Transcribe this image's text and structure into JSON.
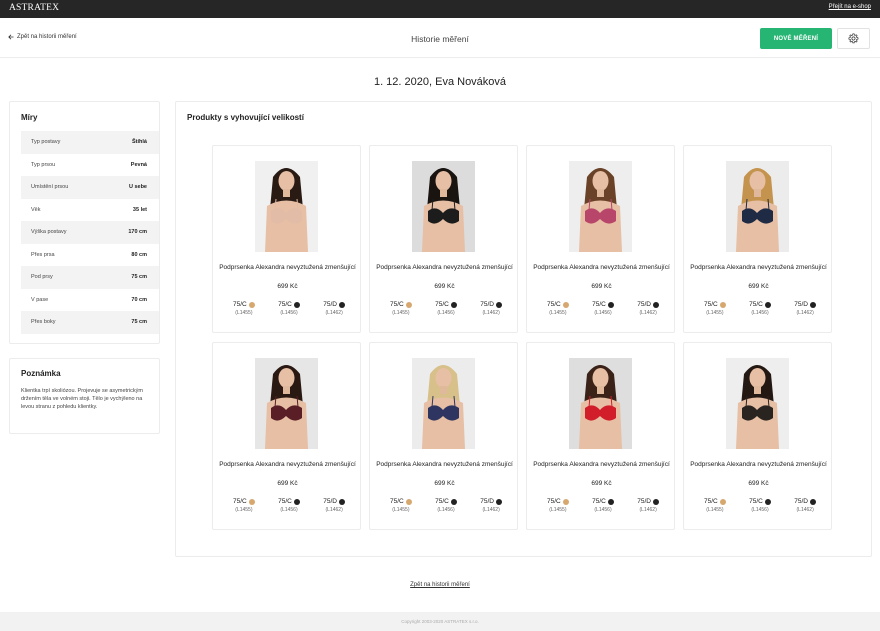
{
  "topbar": {
    "brand": "ASTRATEX",
    "eshop_link": "Přejít na e-shop"
  },
  "header": {
    "back_label": "Zpět na historii měření",
    "title": "Historie měření",
    "new_button": "NOVÉ MĚŘENÍ",
    "settings_icon": "gear-icon"
  },
  "date_title": "1. 12. 2020, Eva Nováková",
  "measurements": {
    "title": "Míry",
    "rows": [
      {
        "label": "Typ postavy",
        "value": "Štíhlá"
      },
      {
        "label": "Typ prsou",
        "value": "Pevná"
      },
      {
        "label": "Umístění prsou",
        "value": "U sebe"
      },
      {
        "label": "Věk",
        "value": "35 let"
      },
      {
        "label": "Výška postavy",
        "value": "170 cm"
      },
      {
        "label": "Přes prsa",
        "value": "80 cm"
      },
      {
        "label": "Pod prsy",
        "value": "75 cm"
      },
      {
        "label": "V pase",
        "value": "70 cm"
      },
      {
        "label": "Přes boky",
        "value": "75 cm"
      }
    ]
  },
  "note": {
    "title": "Poznámka",
    "text": "Klientka trpí skoliózou. Projevuje se asymetrickým držením těla ve volném stoji. Tělo je vychýleno na levou stranu z pohledu klientky."
  },
  "products": {
    "title": "Produkty s vyhovující velikostí",
    "items": [
      {
        "name": "Podprsenka Alexandra nevyztužená zmenšující",
        "price": "699 Kč",
        "bra_color": "#e2bca6",
        "hair_color": "#2a1a14",
        "bg": "#f0f0f0",
        "sizes": [
          {
            "label": "75/C",
            "code": "(L1455)",
            "color": "#d6a86f"
          },
          {
            "label": "75/C",
            "code": "(L1456)",
            "color": "#222222"
          },
          {
            "label": "75/D",
            "code": "(L1462)",
            "color": "#222222"
          }
        ]
      },
      {
        "name": "Podprsenka Alexandra nevyztužená zmenšující",
        "price": "699 Kč",
        "bra_color": "#1c1c1c",
        "hair_color": "#1a1410",
        "bg": "#dcdcdc",
        "sizes": [
          {
            "label": "75/C",
            "code": "(L1455)",
            "color": "#d6a86f"
          },
          {
            "label": "75/C",
            "code": "(L1456)",
            "color": "#222222"
          },
          {
            "label": "75/D",
            "code": "(L1462)",
            "color": "#222222"
          }
        ]
      },
      {
        "name": "Podprsenka Alexandra nevyztužená zmenšující",
        "price": "699 Kč",
        "bra_color": "#b8466a",
        "hair_color": "#6a4228",
        "bg": "#eeeeee",
        "sizes": [
          {
            "label": "75/C",
            "code": "(L1455)",
            "color": "#d6a86f"
          },
          {
            "label": "75/C",
            "code": "(L1456)",
            "color": "#222222"
          },
          {
            "label": "75/D",
            "code": "(L1462)",
            "color": "#222222"
          }
        ]
      },
      {
        "name": "Podprsenka Alexandra nevyztužená zmenšující",
        "price": "699 Kč",
        "bra_color": "#1f2a44",
        "hair_color": "#c4944e",
        "bg": "#ececec",
        "sizes": [
          {
            "label": "75/C",
            "code": "(L1455)",
            "color": "#d6a86f"
          },
          {
            "label": "75/C",
            "code": "(L1456)",
            "color": "#222222"
          },
          {
            "label": "75/D",
            "code": "(L1462)",
            "color": "#222222"
          }
        ]
      },
      {
        "name": "Podprsenka Alexandra nevyztužená zmenšující",
        "price": "699 Kč",
        "bra_color": "#5a1e26",
        "hair_color": "#2a1812",
        "bg": "#e6e6e6",
        "sizes": [
          {
            "label": "75/C",
            "code": "(L1455)",
            "color": "#d6a86f"
          },
          {
            "label": "75/C",
            "code": "(L1456)",
            "color": "#222222"
          },
          {
            "label": "75/D",
            "code": "(L1462)",
            "color": "#222222"
          }
        ]
      },
      {
        "name": "Podprsenka Alexandra nevyztužená zmenšující",
        "price": "699 Kč",
        "bra_color": "#2e3560",
        "hair_color": "#d8c08a",
        "bg": "#ececec",
        "sizes": [
          {
            "label": "75/C",
            "code": "(L1455)",
            "color": "#d6a86f"
          },
          {
            "label": "75/C",
            "code": "(L1456)",
            "color": "#222222"
          },
          {
            "label": "75/D",
            "code": "(L1462)",
            "color": "#222222"
          }
        ]
      },
      {
        "name": "Podprsenka Alexandra nevyztužená zmenšující",
        "price": "699 Kč",
        "bra_color": "#d21e2a",
        "hair_color": "#3a2218",
        "bg": "#dedede",
        "sizes": [
          {
            "label": "75/C",
            "code": "(L1455)",
            "color": "#d6a86f"
          },
          {
            "label": "75/C",
            "code": "(L1456)",
            "color": "#222222"
          },
          {
            "label": "75/D",
            "code": "(L1462)",
            "color": "#222222"
          }
        ]
      },
      {
        "name": "Podprsenka Alexandra nevyztužená zmenšující",
        "price": "699 Kč",
        "bra_color": "#2a2420",
        "hair_color": "#241812",
        "bg": "#eeeeee",
        "sizes": [
          {
            "label": "75/C",
            "code": "(L1455)",
            "color": "#d6a86f"
          },
          {
            "label": "75/C",
            "code": "(L1456)",
            "color": "#222222"
          },
          {
            "label": "75/D",
            "code": "(L1462)",
            "color": "#222222"
          }
        ]
      }
    ]
  },
  "bottom_link": "Zpět na historii měření",
  "footer": "Copyright 2003-2020 ASTRATEX s.r.o.",
  "colors": {
    "accent": "#27b574",
    "topbar": "#262626"
  }
}
